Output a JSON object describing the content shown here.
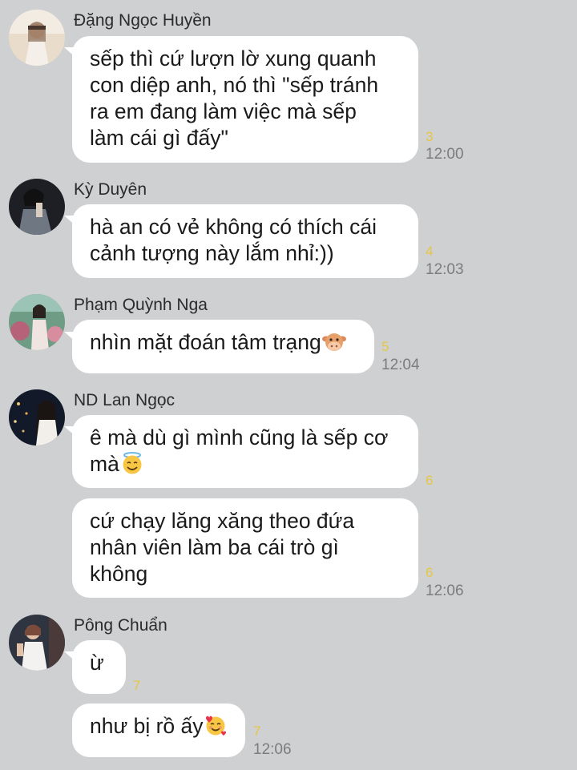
{
  "messages": [
    {
      "sender": "Đặng Ngọc Huyền",
      "lines": [
        "sếp thì cứ lượn lờ xung quanh",
        "con diệp anh, nó thì \"sếp tránh",
        "ra em đang làm việc mà sếp",
        "làm cái gì đấy\""
      ],
      "count": "3",
      "time": "12:00"
    },
    {
      "sender": "Kỳ Duyên",
      "lines": [
        "hà an có vẻ không có thích cái",
        "cảnh tượng này lắm nhỉ:))"
      ],
      "count": "4",
      "time": "12:03"
    },
    {
      "sender": "Phạm Quỳnh Nga",
      "lines": [
        "nhìn mặt đoán tâm trạng"
      ],
      "emoji": "cow-face-emoji",
      "count": "5",
      "time": "12:04"
    },
    {
      "sender": "ND Lan Ngọc",
      "lines": [
        "ê mà dù gì mình cũng là sếp cơ",
        "mà"
      ],
      "emoji": "smiling-face-with-halo-emoji",
      "count": "6"
    },
    {
      "lines": [
        "cứ chạy lăng xăng theo đứa",
        "nhân viên làm ba cái trò gì",
        "không"
      ],
      "count": "6",
      "time": "12:06"
    },
    {
      "sender": "Pông Chuẩn",
      "lines": [
        "ừ"
      ],
      "count": "7"
    },
    {
      "lines": [
        "như bị rồ ấy"
      ],
      "emoji": "smiling-face-with-hearts-emoji",
      "count": "7",
      "time": "12:06"
    }
  ],
  "colors": {
    "background": "#cfd0d2",
    "bubble": "#ffffff",
    "read_count": "#e6c645",
    "timestamp": "#7c7c7c"
  }
}
